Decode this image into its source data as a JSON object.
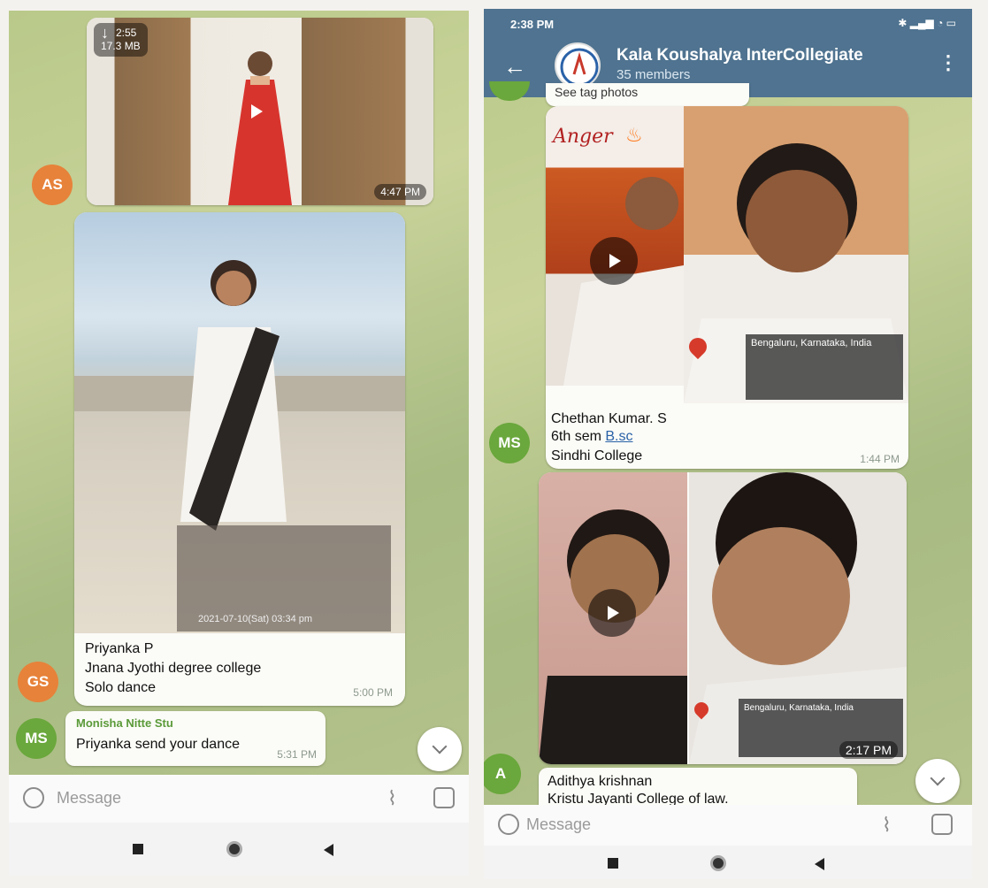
{
  "left": {
    "video_download": {
      "duration": "2:55",
      "size": "17.3 MB",
      "time": "4:47 PM"
    },
    "avatar_as": {
      "initials": "AS",
      "color": "#e7823a"
    },
    "photo_post": {
      "photo_timestamp": "2021-07-10(Sat) 03:34 pm",
      "caption_line1": "Priyanka P",
      "caption_line2": "Jnana Jyothi degree college",
      "caption_line3": "Solo dance",
      "time": "5:00 PM"
    },
    "avatar_gs": {
      "initials": "GS",
      "color": "#e7823a"
    },
    "reply": {
      "sender": "Monisha Nitte Stu",
      "text": "Priyanka send your dance",
      "time": "5:31 PM"
    },
    "avatar_ms": {
      "initials": "MS",
      "color": "#6aa73c"
    },
    "input": {
      "placeholder": "Message"
    }
  },
  "right": {
    "status_bar": {
      "time": "2:38 PM"
    },
    "header": {
      "title": "Kala Koushalya InterCollegiate",
      "subtitle": "35 members"
    },
    "partial_message": {
      "text": "See tag photos"
    },
    "post1": {
      "overlay_text": "Anger",
      "location": "Bengaluru, Karnataka, India",
      "caption_line1": "Chethan Kumar. S",
      "caption_line2_prefix": "6th sem ",
      "caption_line2_link": "B.sc",
      "caption_line3": "Sindhi College",
      "time": "1:44 PM"
    },
    "avatar_ms": {
      "initials": "MS",
      "color": "#6aa73c"
    },
    "post2": {
      "location": "Bengaluru, Karnataka, India",
      "time": "2:17 PM",
      "caption_line1": "Adithya krishnan",
      "caption_line2": "Kristu Jayanti College of law."
    },
    "avatar_a": {
      "initials": "A",
      "color": "#6aa73c"
    },
    "input": {
      "placeholder": "Message"
    }
  }
}
